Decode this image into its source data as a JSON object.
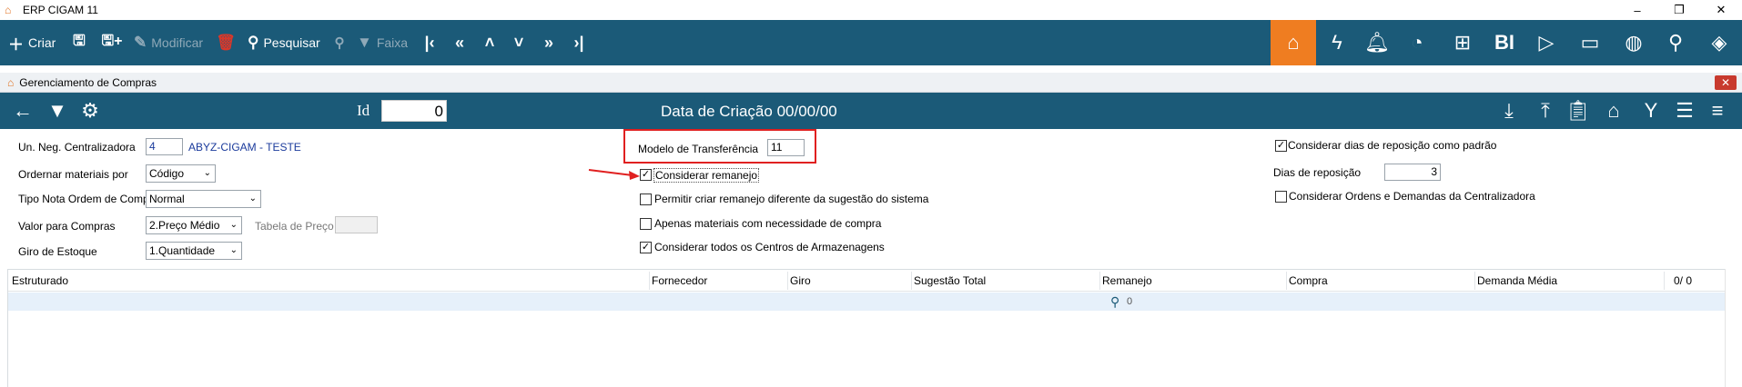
{
  "app": {
    "title": "ERP CIGAM 11"
  },
  "window_controls": {
    "minimize": "–",
    "restore": "❐",
    "close": "✕"
  },
  "toolbar": {
    "criar": "Criar",
    "modificar": "Modificar",
    "pesquisar": "Pesquisar",
    "faixa": "Faixa",
    "bi": "BI"
  },
  "subwindow": {
    "title": "Gerenciamento de Compras",
    "close": "✕"
  },
  "formbar": {
    "id_label": "Id",
    "id_value": "0",
    "date_label": "Data de Criação 00/00/00"
  },
  "form": {
    "un_neg_label": "Un. Neg. Centralizadora",
    "un_neg_value": "4",
    "un_neg_name": "ABYZ-CIGAM - TESTE",
    "ordenar_label": "Ordernar materiais por",
    "ordenar_value": "Código",
    "tipo_nota_label": "Tipo Nota Ordem de Compra",
    "tipo_nota_value": "Normal",
    "valor_label": "Valor para Compras",
    "valor_value": "2.Preço Médio",
    "tabela_label": "Tabela de Preço",
    "giro_label": "Giro de Estoque",
    "giro_value": "1.Quantidade",
    "modelo_label": "Modelo de Transferência",
    "modelo_value": "11",
    "cb_remanejo": "Considerar remanejo",
    "cb_permitir": "Permitir criar remanejo diferente da sugestão do sistema",
    "cb_apenas": "Apenas materiais com necessidade de compra",
    "cb_todos": "Considerar todos os Centros de Armazenagens",
    "cb_dias_padrao": "Considerar dias de reposição como padrão",
    "dias_label": "Dias de reposição",
    "dias_value": "3",
    "cb_ordens": "Considerar Ordens e Demandas da Centralizadora"
  },
  "checkbox_states": {
    "remanejo": true,
    "permitir": false,
    "apenas": false,
    "todos": true,
    "dias_padrao": true,
    "ordens": false
  },
  "grid": {
    "columns": [
      "Estruturado",
      "Fornecedor",
      "Giro",
      "Sugestão Total",
      "Remanejo",
      "Compra",
      "Demanda Média",
      "0/ 0"
    ],
    "row_value": "0"
  },
  "colors": {
    "toolbar": "#1b5a78",
    "accent": "#ef7d21",
    "annotation": "#e02020"
  }
}
